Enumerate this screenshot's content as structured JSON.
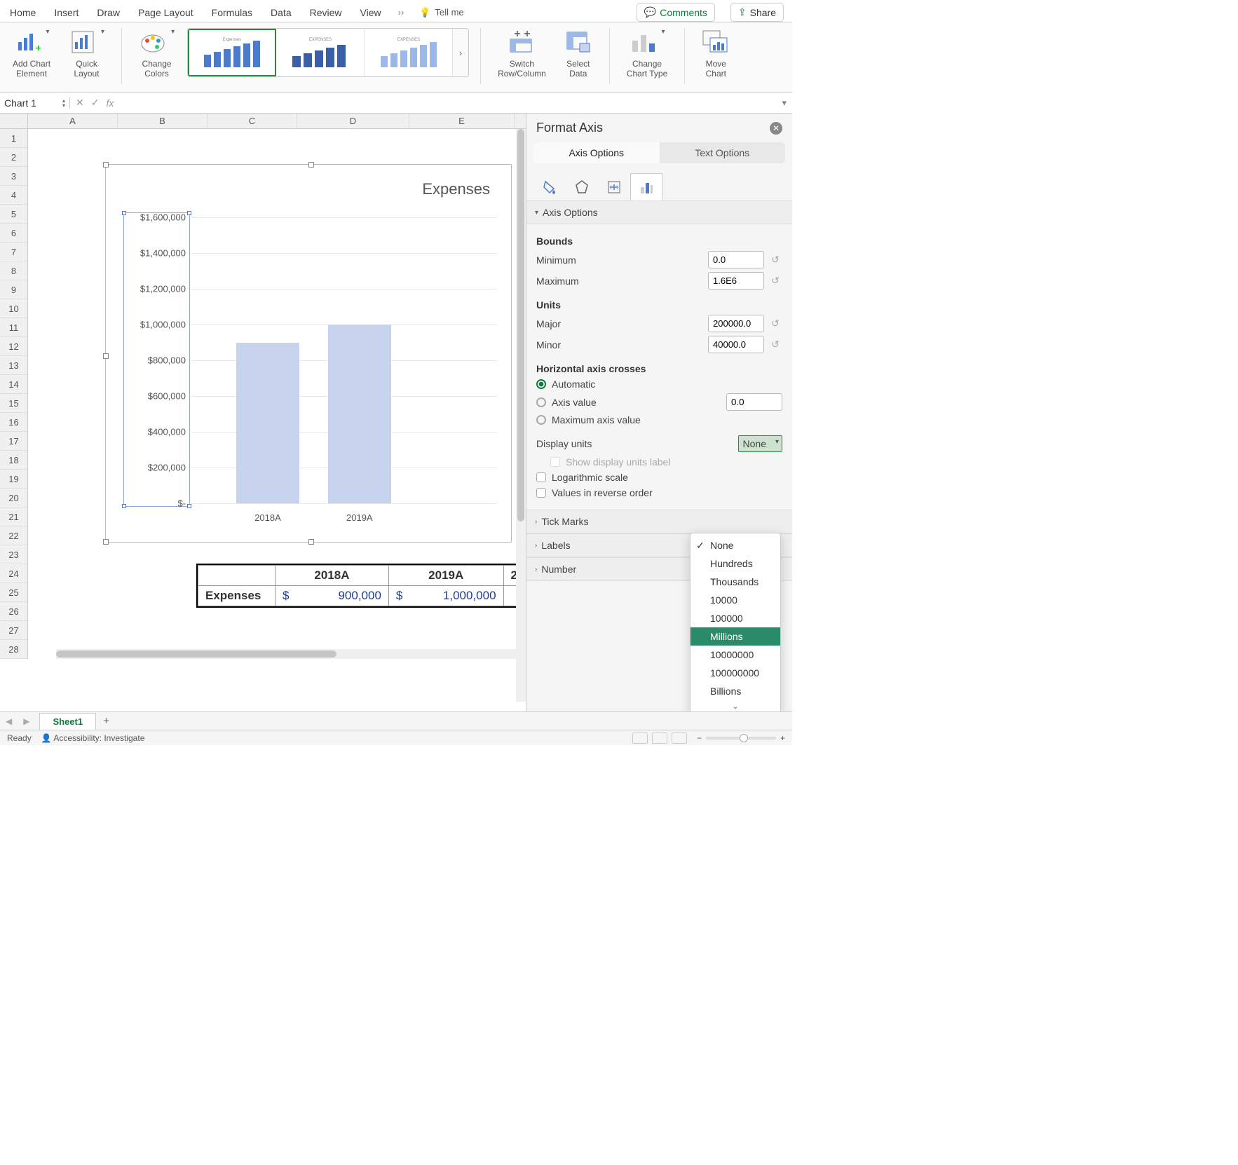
{
  "ribbon_tabs": [
    "Home",
    "Insert",
    "Draw",
    "Page Layout",
    "Formulas",
    "Data",
    "Review",
    "View"
  ],
  "tell_me": "Tell me",
  "comments_btn": "Comments",
  "share_btn": "Share",
  "ribbon": {
    "add_chart_element": "Add Chart\nElement",
    "quick_layout": "Quick\nLayout",
    "change_colors": "Change\nColors",
    "switch_row_col": "Switch\nRow/Column",
    "select_data": "Select\nData",
    "change_chart_type": "Change\nChart Type",
    "move_chart": "Move\nChart",
    "style_title": "Expenses",
    "style_title2": "EXPENSES",
    "style_title3": "EXPENSES"
  },
  "name_box": "Chart 1",
  "columns": [
    "A",
    "B",
    "C",
    "D",
    "E"
  ],
  "rows": [
    "1",
    "2",
    "3",
    "4",
    "5",
    "6",
    "7",
    "8",
    "9",
    "10",
    "11",
    "12",
    "13",
    "14",
    "15",
    "16",
    "17",
    "18",
    "19",
    "20",
    "21",
    "22",
    "23",
    "24",
    "25",
    "26",
    "27",
    "28"
  ],
  "chart": {
    "title": "Expenses",
    "y_ticks": [
      "$1,600,000",
      "$1,400,000",
      "$1,200,000",
      "$1,000,000",
      "$800,000",
      "$600,000",
      "$400,000",
      "$200,000",
      "$-"
    ],
    "x_labels": [
      "2018A",
      "2019A"
    ]
  },
  "chart_data": {
    "type": "bar",
    "title": "Expenses",
    "categories": [
      "2018A",
      "2019A"
    ],
    "values": [
      900000,
      1000000
    ],
    "ylim": [
      0,
      1600000
    ],
    "y_major": 200000,
    "y_format": "currency"
  },
  "table": {
    "headers": [
      "",
      "2018A",
      "2019A",
      "2"
    ],
    "row_label": "Expenses",
    "curr": "$",
    "values": [
      "900,000",
      "1,000,000"
    ]
  },
  "pane": {
    "title": "Format Axis",
    "tab_axis": "Axis Options",
    "tab_text": "Text Options",
    "section_axis_options": "Axis Options",
    "bounds": "Bounds",
    "minimum": "Minimum",
    "minimum_val": "0.0",
    "maximum": "Maximum",
    "maximum_val": "1.6E6",
    "units": "Units",
    "major": "Major",
    "major_val": "200000.0",
    "minor": "Minor",
    "minor_val": "40000.0",
    "hcross": "Horizontal axis crosses",
    "automatic": "Automatic",
    "axis_value": "Axis value",
    "axis_value_val": "0.0",
    "max_axis_value": "Maximum axis value",
    "display_units": "Display units",
    "display_units_val": "None",
    "show_du_label": "Show display units label",
    "log_scale": "Logarithmic scale",
    "reverse": "Values in reverse order",
    "tick_marks": "Tick Marks",
    "labels": "Labels",
    "number": "Number"
  },
  "dropdown_options": [
    "None",
    "Hundreds",
    "Thousands",
    "10000",
    "100000",
    "Millions",
    "10000000",
    "100000000",
    "Billions"
  ],
  "dropdown_selected": "None",
  "dropdown_highlight": "Millions",
  "sheet_tab": "Sheet1",
  "status_ready": "Ready",
  "status_acc": "Accessibility: Investigate"
}
